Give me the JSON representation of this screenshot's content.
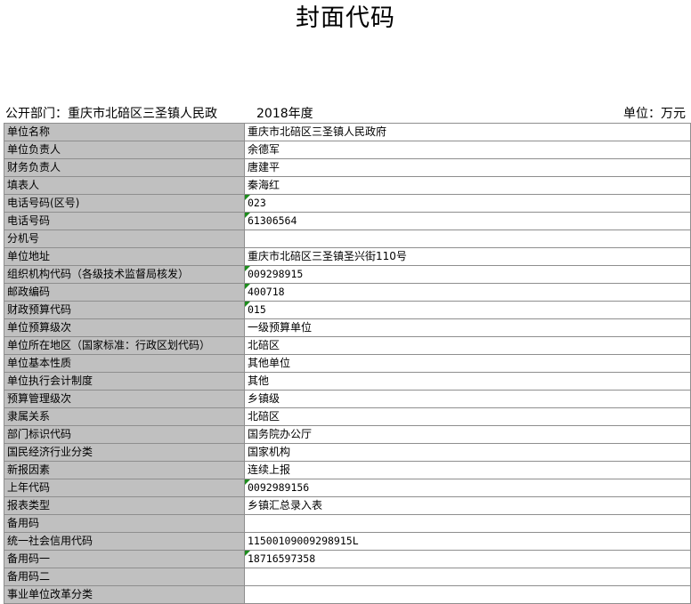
{
  "title": "封面代码",
  "dept_label": "公开部门：重庆市北碚区三圣镇人民政",
  "year": "2018年度",
  "unit": "单位：万元",
  "rows": [
    {
      "label": "单位名称",
      "value": "重庆市北碚区三圣镇人民政府"
    },
    {
      "label": "单位负责人",
      "value": "余德军"
    },
    {
      "label": "财务负责人",
      "value": "唐建平"
    },
    {
      "label": "填表人",
      "value": "秦海红"
    },
    {
      "label": "电话号码(区号)",
      "value": "023"
    },
    {
      "label": "电话号码",
      "value": "61306564"
    },
    {
      "label": "分机号",
      "value": ""
    },
    {
      "label": "单位地址",
      "value": "重庆市北碚区三圣镇圣兴街110号"
    },
    {
      "label": "组织机构代码（各级技术监督局核发）",
      "value": "009298915"
    },
    {
      "label": "邮政编码",
      "value": "400718"
    },
    {
      "label": "财政预算代码",
      "value": "015"
    },
    {
      "label": "单位预算级次",
      "value": "一级预算单位"
    },
    {
      "label": "单位所在地区（国家标准：行政区划代码）",
      "value": "北碚区"
    },
    {
      "label": "单位基本性质",
      "value": "其他单位"
    },
    {
      "label": "单位执行会计制度",
      "value": "其他"
    },
    {
      "label": "预算管理级次",
      "value": "乡镇级"
    },
    {
      "label": "隶属关系",
      "value": "北碚区"
    },
    {
      "label": "部门标识代码",
      "value": "国务院办公厅"
    },
    {
      "label": "国民经济行业分类",
      "value": "国家机构"
    },
    {
      "label": "新报因素",
      "value": "连续上报"
    },
    {
      "label": "上年代码",
      "value": "0092989156"
    },
    {
      "label": "报表类型",
      "value": "乡镇汇总录入表"
    },
    {
      "label": "备用码",
      "value": ""
    },
    {
      "label": "统一社会信用代码",
      "value": "11500109009298915L"
    },
    {
      "label": "备用码一",
      "value": "18716597358"
    },
    {
      "label": "备用码二",
      "value": ""
    },
    {
      "label": "事业单位改革分类",
      "value": ""
    }
  ]
}
